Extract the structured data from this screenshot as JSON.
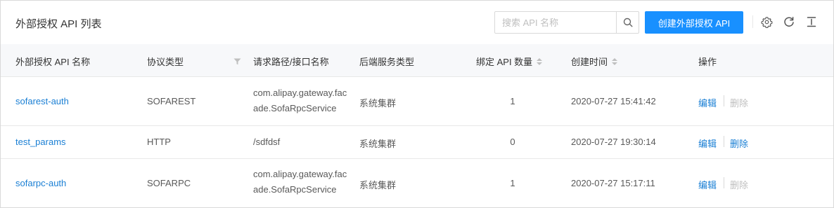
{
  "header": {
    "title": "外部授权 API 列表",
    "search_placeholder": "搜索 API 名称",
    "search_value": "",
    "create_label": "创建外部授权 API",
    "icons": [
      "search-icon",
      "settings-icon",
      "refresh-icon",
      "export-icon"
    ]
  },
  "table": {
    "columns": {
      "name": "外部授权 API 名称",
      "protocol": "协议类型",
      "path": "请求路径/接口名称",
      "backend": "后端服务类型",
      "count": "绑定 API 数量",
      "created": "创建时间",
      "actions": "操作"
    },
    "rows": [
      {
        "name": "sofarest-auth",
        "protocol": "SOFAREST",
        "path": "com.alipay.gateway.facade.SofaRpcService",
        "backend": "系统集群",
        "count": "1",
        "created": "2020-07-27 15:41:42",
        "edit": "编辑",
        "delete": "删除",
        "delete_enabled": false
      },
      {
        "name": "test_params",
        "protocol": "HTTP",
        "path": "/sdfdsf",
        "backend": "系统集群",
        "count": "0",
        "created": "2020-07-27 19:30:14",
        "edit": "编辑",
        "delete": "删除",
        "delete_enabled": true
      },
      {
        "name": "sofarpc-auth",
        "protocol": "SOFARPC",
        "path": "com.alipay.gateway.facade.SofaRpcService",
        "backend": "系统集群",
        "count": "1",
        "created": "2020-07-27 15:17:11",
        "edit": "编辑",
        "delete": "删除",
        "delete_enabled": false
      }
    ]
  },
  "colors": {
    "primary": "#1890ff",
    "link": "#1a7fd4",
    "disabled": "#bfbfbf",
    "header_bg": "#f7f8fa"
  }
}
